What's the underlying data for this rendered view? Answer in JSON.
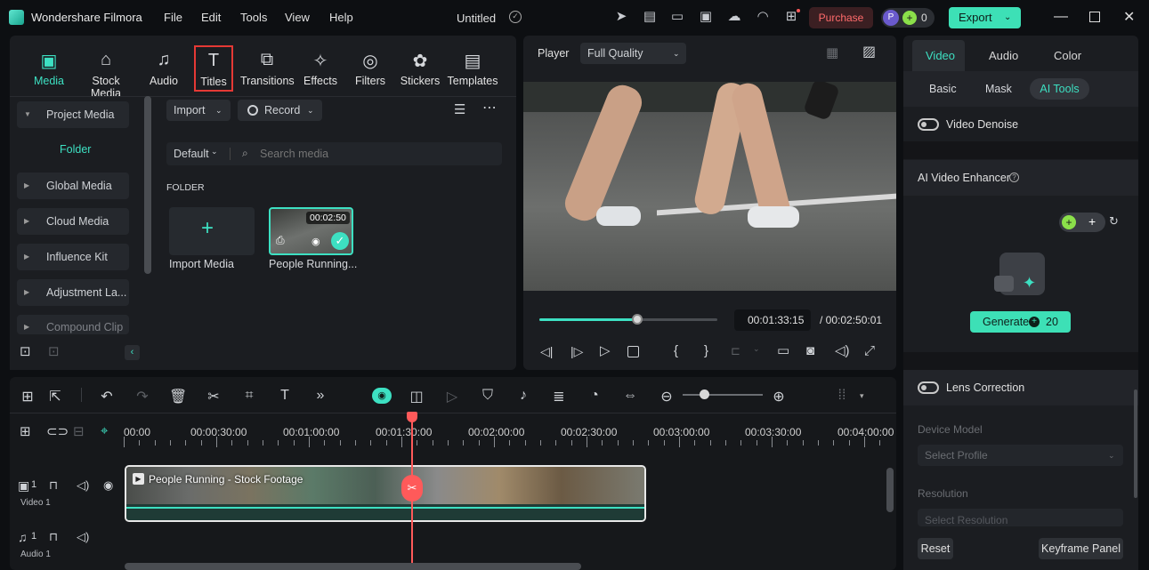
{
  "app": {
    "name": "Wondershare Filmora",
    "title": "Untitled"
  },
  "menu": [
    "File",
    "Edit",
    "Tools",
    "View",
    "Help"
  ],
  "header": {
    "purchase": "Purchase",
    "avatar_letter": "P",
    "credits": "0",
    "export": "Export"
  },
  "media_tabs": [
    {
      "label": "Media",
      "icon": "media-icon"
    },
    {
      "label": "Stock Media",
      "icon": "stock-media-icon"
    },
    {
      "label": "Audio",
      "icon": "audio-icon"
    },
    {
      "label": "Titles",
      "icon": "titles-icon"
    },
    {
      "label": "Transitions",
      "icon": "transitions-icon"
    },
    {
      "label": "Effects",
      "icon": "effects-icon"
    },
    {
      "label": "Filters",
      "icon": "filters-icon"
    },
    {
      "label": "Stickers",
      "icon": "stickers-icon"
    },
    {
      "label": "Templates",
      "icon": "templates-icon"
    }
  ],
  "sidebar": {
    "items": [
      "Project Media",
      "Folder",
      "Global Media",
      "Cloud Media",
      "Influence Kit",
      "Adjustment La...",
      "Compound Clip"
    ]
  },
  "media_toolbar": {
    "import": "Import",
    "record": "Record",
    "sort": "Default",
    "search_placeholder": "Search media",
    "folder_heading": "FOLDER"
  },
  "media_items": [
    {
      "label": "Import Media"
    },
    {
      "label": "People Running...",
      "duration": "00:02:50"
    }
  ],
  "player": {
    "label": "Player",
    "quality": "Full Quality",
    "current_time": "00:01:33:15",
    "total_time": "/  00:02:50:01",
    "progress": 0.55
  },
  "right_panel": {
    "tabs": [
      "Video",
      "Audio",
      "Color"
    ],
    "subtabs": [
      "Basic",
      "Mask",
      "AI Tools"
    ],
    "video_denoise": "Video Denoise",
    "ai_enhancer": "AI Video Enhancer",
    "generate": "Generate",
    "generate_cost": "20",
    "lens_correction": "Lens Correction",
    "device_model": "Device Model",
    "select_profile": "Select Profile",
    "resolution": "Resolution",
    "select_resolution": "Select Resolution",
    "reset": "Reset",
    "keyframe": "Keyframe Panel"
  },
  "timeline": {
    "ruler": [
      "00:00",
      "00:00:30:00",
      "00:01:00:00",
      "00:01:30:00",
      "00:02:00:00",
      "00:02:30:00",
      "00:03:00:00",
      "00:03:30:00",
      "00:04:00:00"
    ],
    "clip_title": "People Running - Stock Footage",
    "video_track": "Video 1",
    "audio_track": "Audio 1",
    "video_track_num": "1",
    "audio_track_num": "1"
  },
  "colors": {
    "accent": "#3de0c2",
    "playhead": "#ff5a5a",
    "export": "#3de0b6"
  }
}
